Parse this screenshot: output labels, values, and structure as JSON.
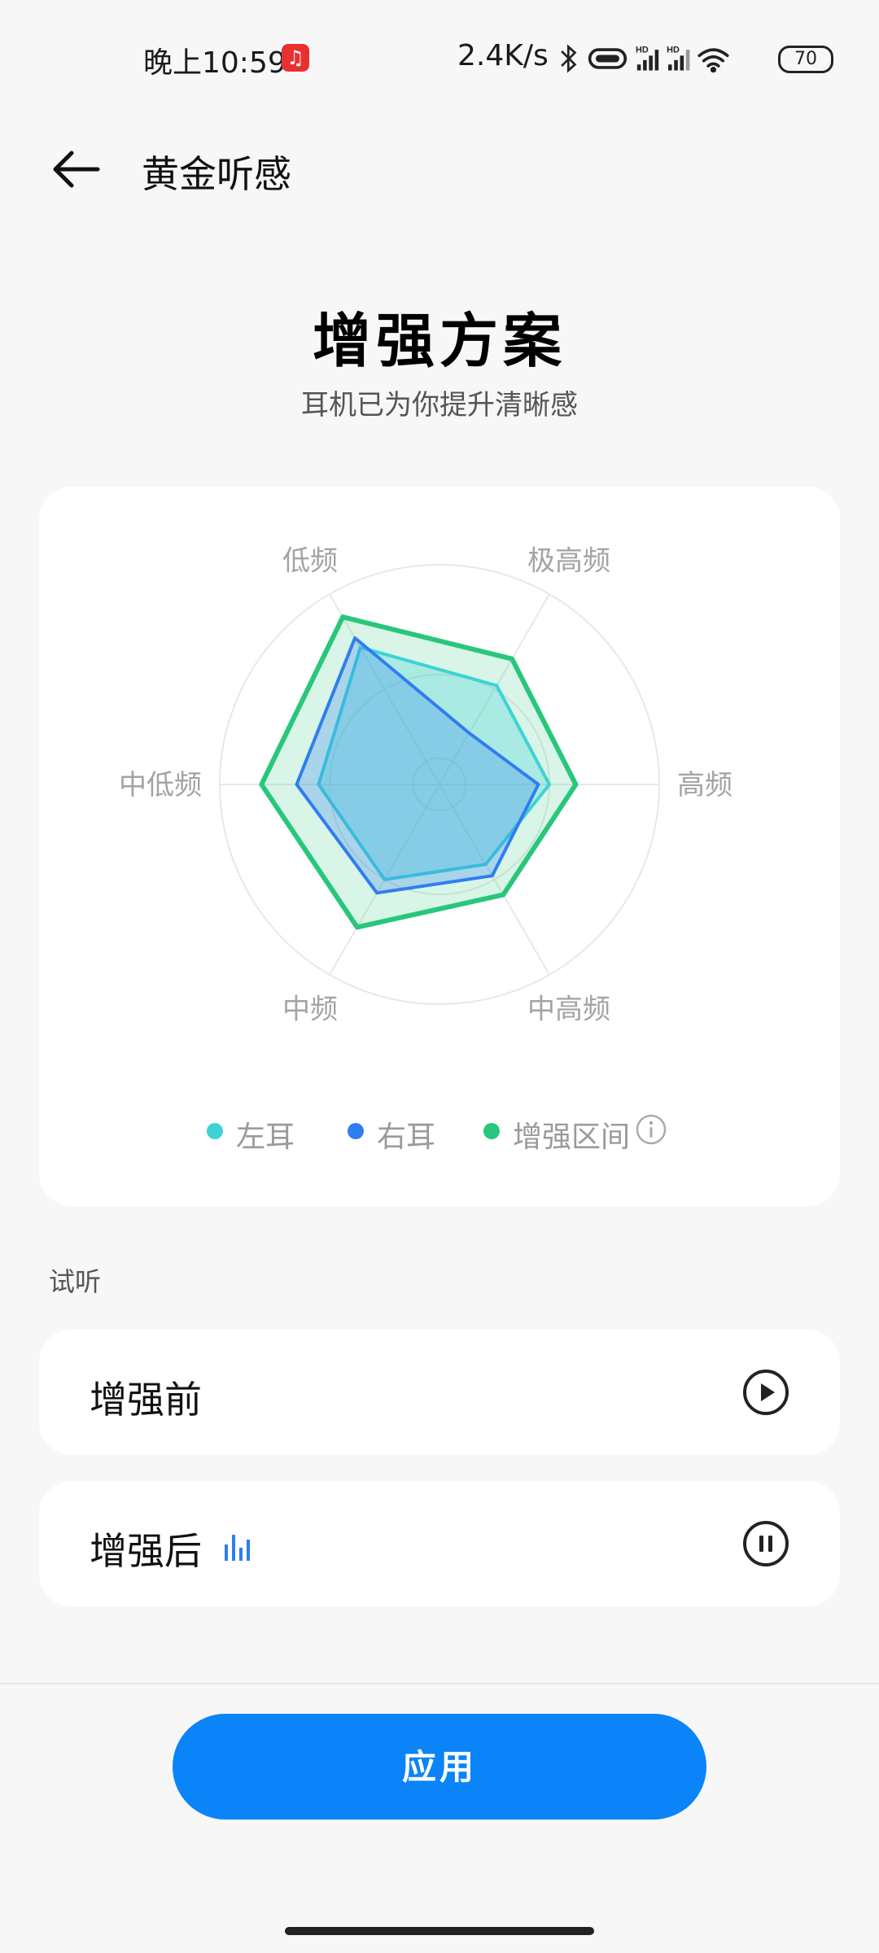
{
  "status_bar": {
    "time": "晚上10:59",
    "app_icon": "netease-music-icon",
    "net_speed": "2.4K/s",
    "icons": [
      "bluetooth-icon",
      "earbuds-icon",
      "hd-signal-icon",
      "hd-signal-icon",
      "wifi-icon"
    ],
    "battery": "70"
  },
  "header": {
    "back_icon": "arrow-left-icon",
    "title": "黄金听感"
  },
  "hero": {
    "title": "增强方案",
    "subtitle": "耳机已为你提升清晰感"
  },
  "chart_data": {
    "type": "radar",
    "axes": [
      "低频",
      "极高频",
      "高频",
      "中高频",
      "中频",
      "中低频"
    ],
    "range": [
      0,
      1
    ],
    "series": [
      {
        "name": "左耳",
        "color": "#3dd3d6",
        "values": [
          0.72,
          0.52,
          0.5,
          0.42,
          0.5,
          0.55
        ]
      },
      {
        "name": "右耳",
        "color": "#2f7ef0",
        "values": [
          0.77,
          0.27,
          0.45,
          0.48,
          0.57,
          0.65
        ]
      },
      {
        "name": "增强区间",
        "color": "#28c77b",
        "values": [
          0.88,
          0.66,
          0.62,
          0.58,
          0.75,
          0.81
        ]
      }
    ],
    "legend_info_icon": "info-icon"
  },
  "listen": {
    "section_label": "试听",
    "items": [
      {
        "label": "增强前",
        "icon": "play-icon",
        "playing": false
      },
      {
        "label": "增强后",
        "icon": "pause-icon",
        "playing": true,
        "indicator_icon": "equalizer-bars-icon"
      }
    ]
  },
  "apply_label": "应用",
  "colors": {
    "accent": "#0a84f8",
    "left": "#3dd3d6",
    "right": "#2f7ef0",
    "enhanced": "#28c77b"
  }
}
